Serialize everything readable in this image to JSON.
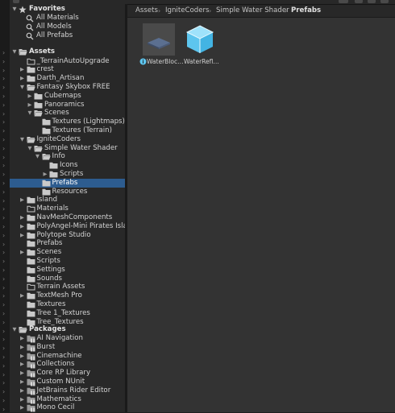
{
  "favorites": {
    "title": "Favorites",
    "items": [
      "All Materials",
      "All Models",
      "All Prefabs"
    ]
  },
  "assets": {
    "title": "Assets",
    "items": [
      "_TerrainAutoUpgrade",
      "crest",
      "Darth_Artisan",
      "Fantasy Skybox FREE",
      "Cubemaps",
      "Panoramics",
      "Scenes",
      "Textures (Lightmaps)",
      "Textures (Terrain)",
      "IgniteCoders",
      "Simple Water Shader",
      "Info",
      "Icons",
      "Scripts",
      "Prefabs",
      "Resources",
      "Island",
      "Materials",
      "NavMeshComponents",
      "PolyAngel-Mini Pirates Islan",
      "Polytope Studio",
      "Prefabs",
      "Scenes",
      "Scripts",
      "Settings",
      "Sounds",
      "Terrain Assets",
      "TextMesh Pro",
      "Textures",
      "Tree 1_Textures",
      "Tree_Textures"
    ]
  },
  "packages": {
    "title": "Packages",
    "items": [
      "AI Navigation",
      "Burst",
      "Cinemachine",
      "Collections",
      "Core RP Library",
      "Custom NUnit",
      "JetBrains Rider Editor",
      "Mathematics",
      "Mono Cecil"
    ]
  },
  "breadcrumb": [
    "Assets",
    "IgniteCoders",
    "Simple Water Shader",
    "Prefabs"
  ],
  "breadcrumb_separator": "›",
  "assets_grid": [
    {
      "label": "WaterBloc…",
      "icon": "prefab-variant-thumbnail",
      "badge": "info-badge-icon"
    },
    {
      "label": "WaterRefl…",
      "icon": "prefab-cube-icon"
    }
  ],
  "colors": {
    "selection": "#2d5c8f",
    "folder": "#c9c9c9",
    "prefab": "#5dc5ee",
    "package": "#9a9a9a"
  }
}
